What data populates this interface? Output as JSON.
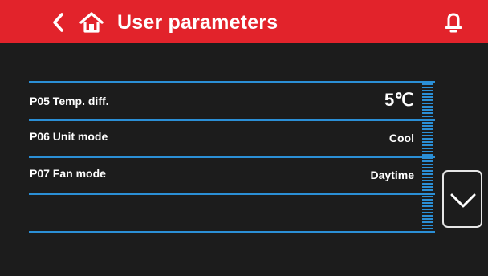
{
  "header": {
    "title": "User parameters",
    "bar_color": "#e2232b",
    "icons": [
      "chevron-left-icon",
      "home-icon",
      "bell-icon"
    ]
  },
  "parameters": [
    {
      "label": "P05 Temp. diff.",
      "value": "5℃"
    },
    {
      "label": "P06 Unit mode",
      "value": "Cool"
    },
    {
      "label": "P07 Fan mode",
      "value": "Daytime"
    }
  ],
  "colors": {
    "background": "#1c1c1c",
    "divider": "#2b8fd6",
    "text": "#ffffff"
  },
  "scroll": {
    "icon": "chevron-down-icon"
  }
}
